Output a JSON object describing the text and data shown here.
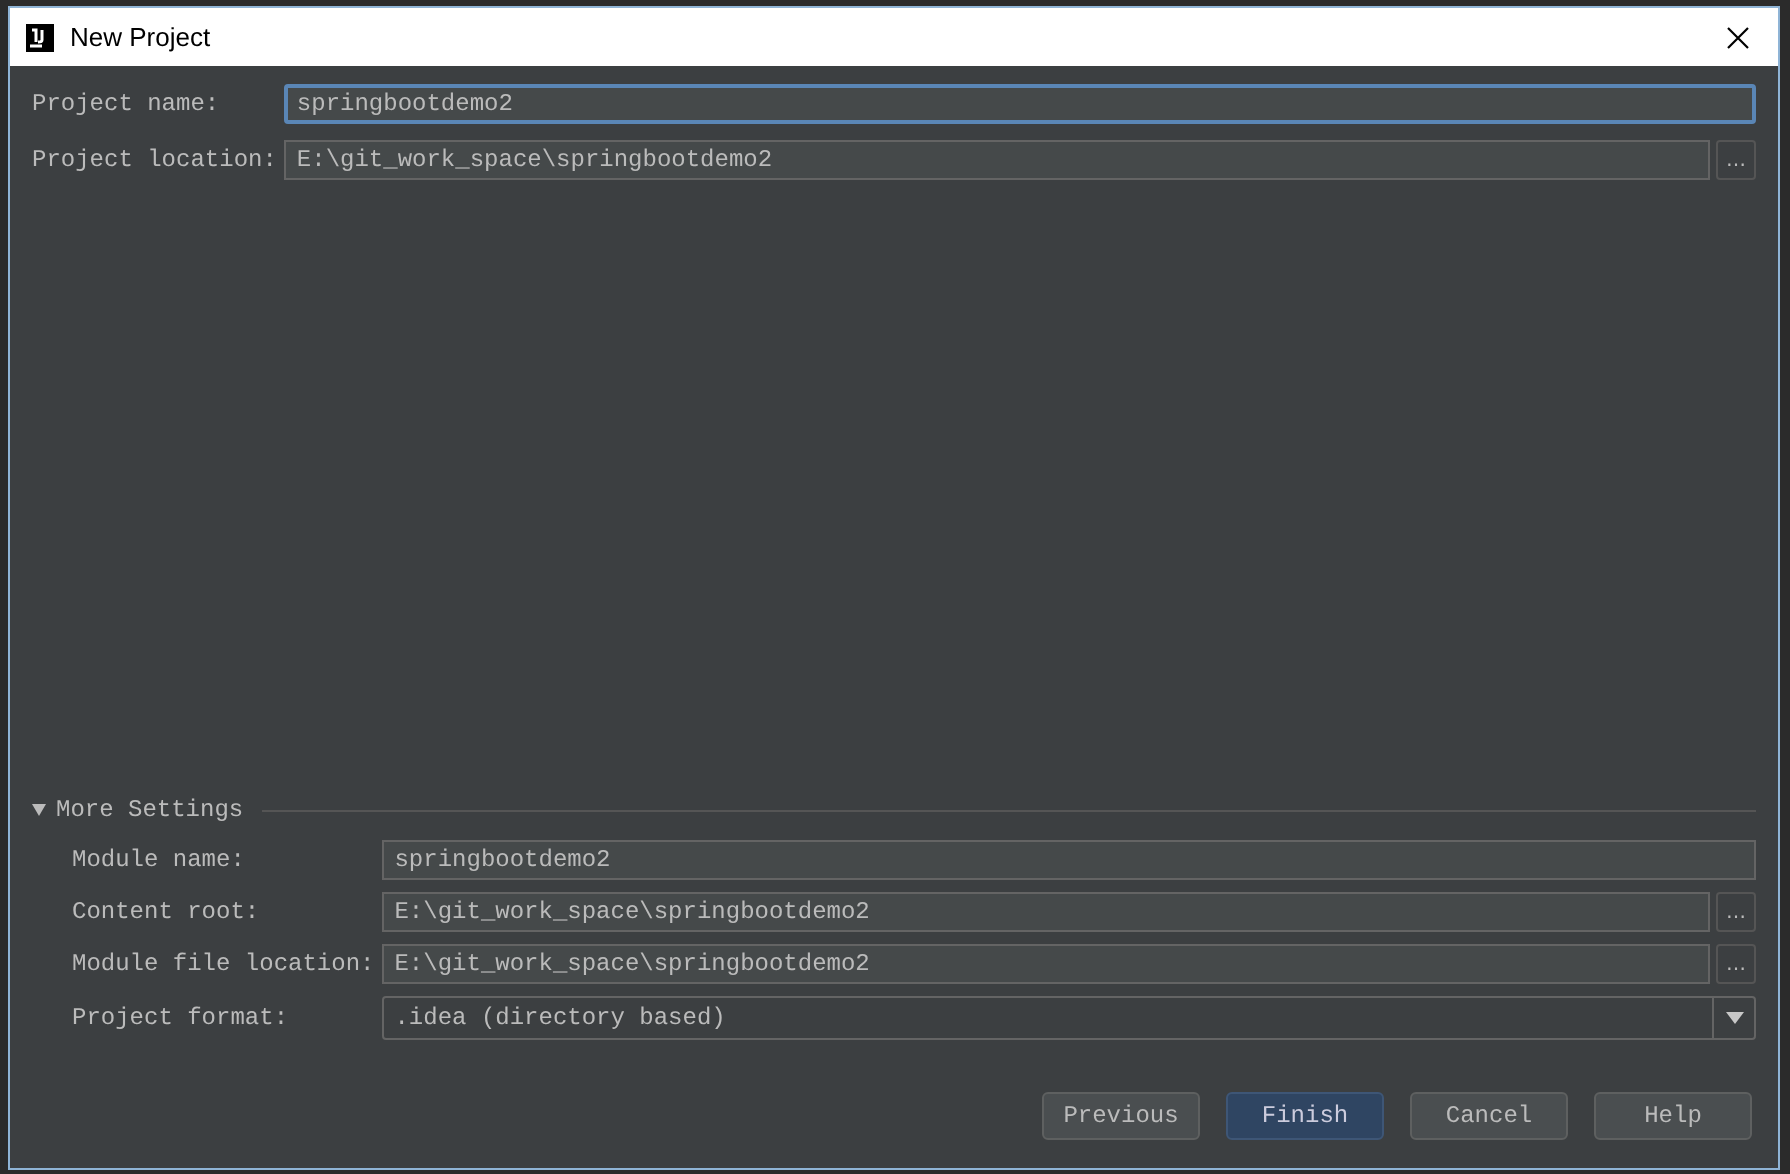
{
  "window": {
    "title": "New Project"
  },
  "fields": [
    {
      "kind": "text",
      "label": "Project name:",
      "value": "springbootdemo2",
      "focused": true
    },
    {
      "kind": "path",
      "label": "Project location:",
      "value": "E:\\git_work_space\\springbootdemo2",
      "focused": false,
      "browse": "…"
    }
  ],
  "more_settings": {
    "title": "More Settings",
    "expanded": true,
    "fields": [
      {
        "kind": "text",
        "label": "Module name:",
        "value": "springbootdemo2"
      },
      {
        "kind": "path",
        "label": "Content root:",
        "value": "E:\\git_work_space\\springbootdemo2",
        "browse": "…"
      },
      {
        "kind": "path",
        "label": "Module file location:",
        "value": "E:\\git_work_space\\springbootdemo2",
        "browse": "…"
      },
      {
        "kind": "select",
        "label": "Project format:",
        "value": ".idea (directory based)"
      }
    ]
  },
  "buttons": [
    {
      "label": "Previous",
      "default": false
    },
    {
      "label": "Finish",
      "default": true
    },
    {
      "label": "Cancel",
      "default": false
    },
    {
      "label": "Help",
      "default": false
    }
  ]
}
